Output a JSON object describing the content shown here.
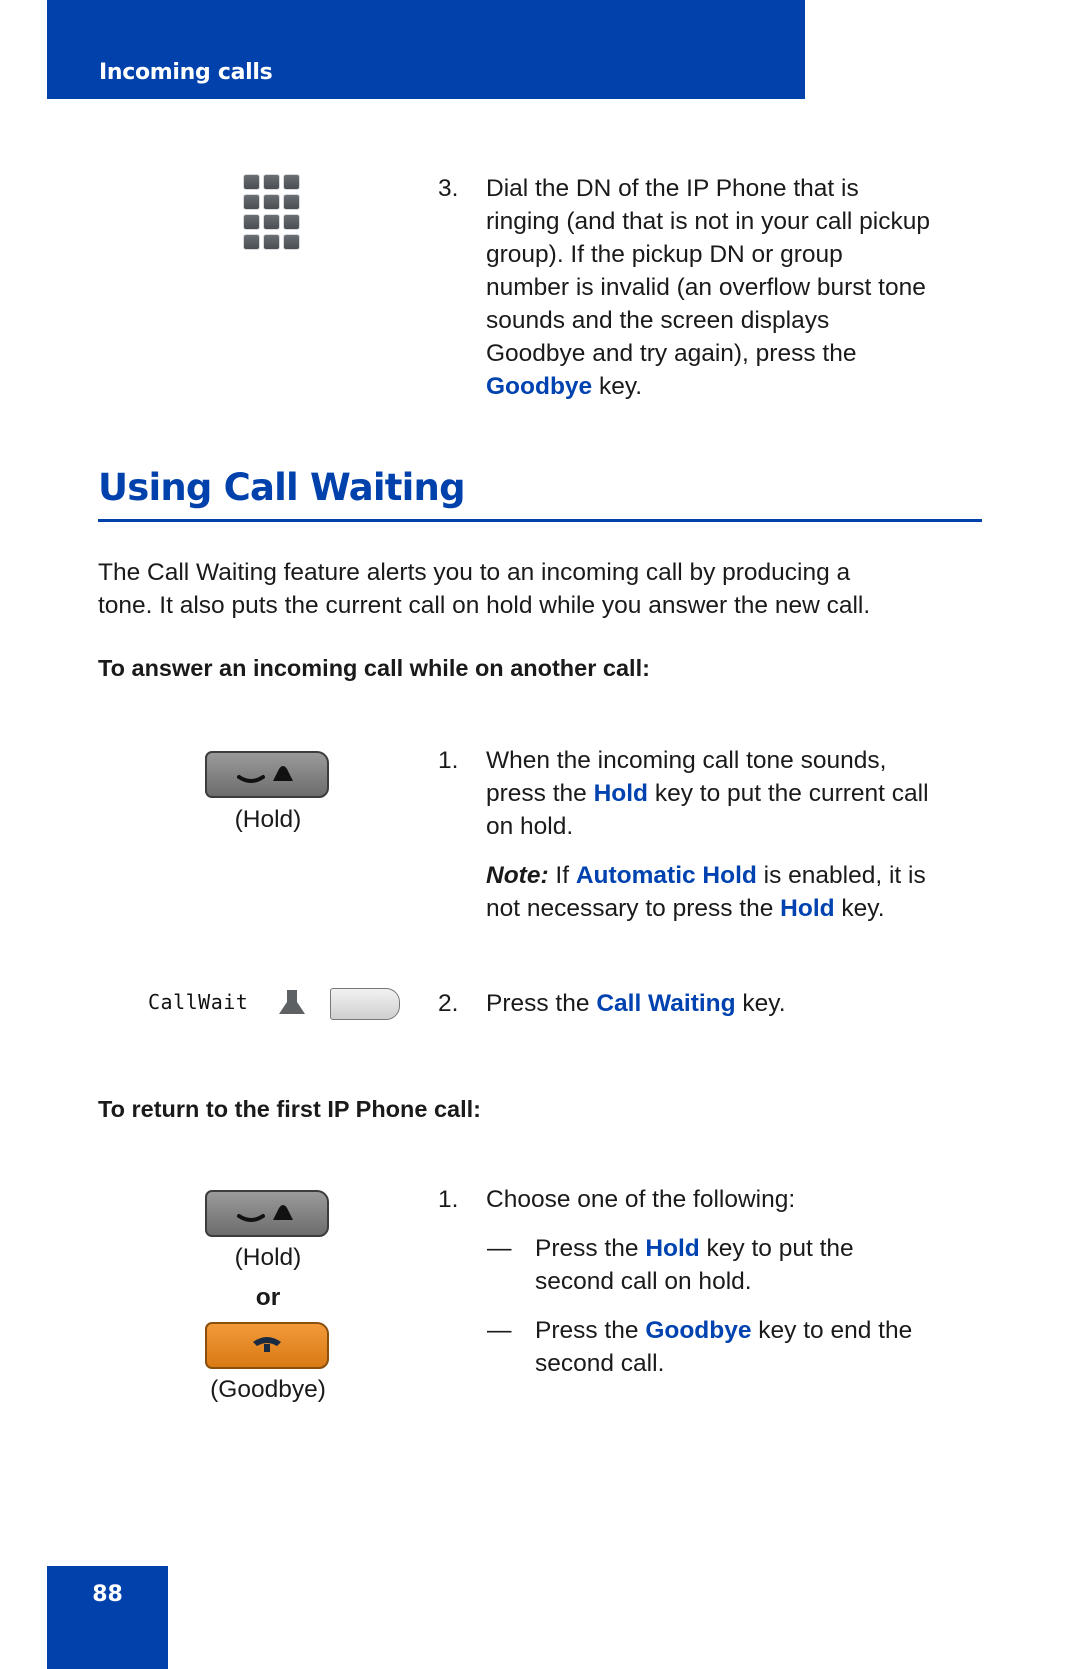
{
  "header": {
    "title": "Incoming calls"
  },
  "page_number": "88",
  "pickup_step": {
    "number": "3.",
    "lines": [
      "Dial the DN of the IP Phone that is",
      "ringing (and that is not in your call pickup",
      "group). If the pickup DN or group",
      "number is invalid (an overflow burst tone",
      "sounds and the screen displays",
      "Goodbye and try again), press the"
    ],
    "last_line_key": "Goodbye",
    "last_line_rest": " key."
  },
  "section": {
    "title": "Using Call Waiting",
    "intro_lines": [
      "The Call Waiting feature alerts you to an incoming call by producing a",
      "tone. It also puts the current call on hold while you answer the new call."
    ]
  },
  "answer_procedure": {
    "heading": "To answer an incoming call while on another call:",
    "hold_caption": "(Hold)",
    "step1": {
      "number": "1.",
      "line1": "When the incoming call tone sounds,",
      "line2_pre": "press the ",
      "line2_key": "Hold",
      "line2_post": " key to put the current call",
      "line3": "on hold."
    },
    "note": {
      "label": "Note:",
      "pre": " If ",
      "key1": "Automatic Hold",
      "mid": " is enabled, it is",
      "line2_pre": "not necessary to press the ",
      "key2": "Hold",
      "line2_post": " key."
    },
    "softkey_label": "CallWait",
    "step2": {
      "number": "2.",
      "pre": "Press the ",
      "key": "Call Waiting",
      "post": " key."
    }
  },
  "return_procedure": {
    "heading": "To return to the first IP Phone call:",
    "hold_caption": "(Hold)",
    "or_label": "or",
    "goodbye_caption": "(Goodbye)",
    "step1": {
      "number": "1.",
      "text": "Choose one of the following:"
    },
    "options": [
      {
        "dash": "—",
        "pre": "Press the ",
        "key": "Hold",
        "post": " key to put the",
        "line2": "second call on hold."
      },
      {
        "dash": "—",
        "pre": "Press the ",
        "key": "Goodbye",
        "post": " key to end the",
        "line2": "second call."
      }
    ]
  },
  "colors": {
    "brand_blue": "#0041ac",
    "keyword_blue": "#0043b0",
    "goodbye_orange": "#e88a22"
  }
}
